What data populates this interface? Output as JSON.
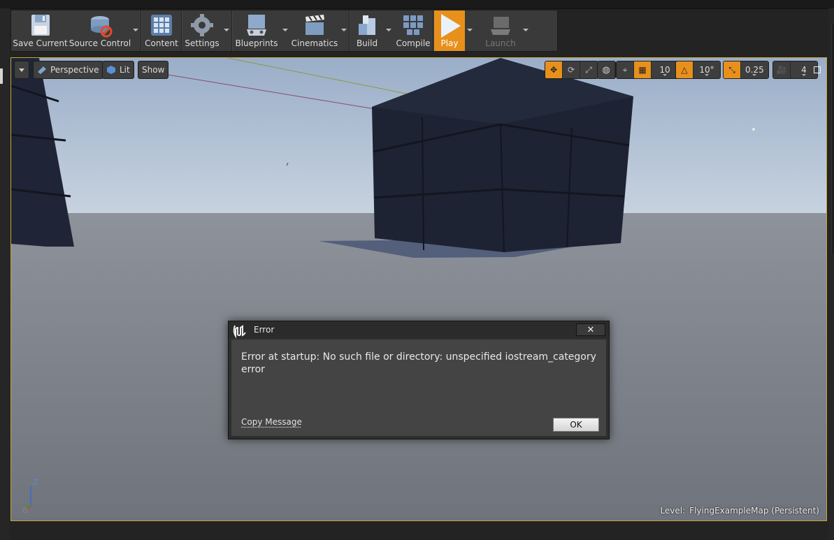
{
  "toolbar": {
    "buttons": [
      {
        "label": "Save Current",
        "icon": "save-icon"
      },
      {
        "label": "Source Control",
        "icon": "source-control-icon"
      },
      {
        "label": "Content",
        "icon": "content-icon"
      },
      {
        "label": "Settings",
        "icon": "settings-icon"
      },
      {
        "label": "Blueprints",
        "icon": "blueprints-icon"
      },
      {
        "label": "Cinematics",
        "icon": "cinematics-icon"
      },
      {
        "label": "Build",
        "icon": "build-icon"
      },
      {
        "label": "Compile",
        "icon": "compile-icon"
      },
      {
        "label": "Play",
        "icon": "play-icon"
      },
      {
        "label": "Launch",
        "icon": "launch-icon",
        "disabled": true
      }
    ]
  },
  "viewport": {
    "view_mode": "Perspective",
    "lighting": "Lit",
    "show": "Show",
    "grid_snap": "10",
    "rotation_snap": "10°",
    "scale_snap": "0.25",
    "camera_speed": "4",
    "level_label": "Level:",
    "level_name": "FlyingExampleMap (Persistent)",
    "axis_z": "Z"
  },
  "dialog": {
    "title": "Error",
    "message": "Error at startup: No such file or directory: unspecified iostream_category error",
    "copy_label": "Copy Message",
    "ok_label": "OK",
    "close_symbol": "✕"
  },
  "colors": {
    "accent": "#e8901c",
    "sky_top": "#9fb1c9",
    "floor": "#7f838b",
    "dialog_bg": "#444444"
  }
}
